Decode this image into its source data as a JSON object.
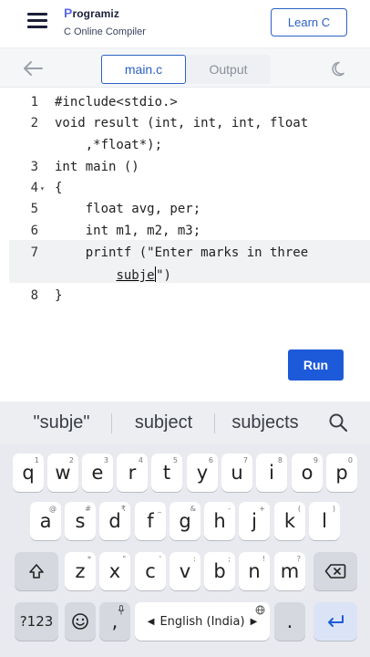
{
  "header": {
    "brand_initial": "P",
    "brand_rest": "rogramiz",
    "subtitle": "C Online Compiler",
    "learn_button": "Learn C"
  },
  "toolbar": {
    "tab_main": "main.c",
    "tab_output": "Output",
    "back_icon": "arrow-left-icon",
    "theme_icon": "moon-icon"
  },
  "editor": {
    "lines": [
      {
        "num": "1",
        "code": "#include<stdio.>"
      },
      {
        "num": "2",
        "code": "void result (int, int, int, float"
      },
      {
        "num": "",
        "code": "    ,*float*);"
      },
      {
        "num": "3",
        "code": "int main ()"
      },
      {
        "num": "4",
        "code": "{"
      },
      {
        "num": "5",
        "code": "    float avg, per;"
      },
      {
        "num": "6",
        "code": "    int m1, m2, m3;"
      },
      {
        "num": "7",
        "code": "    printf (\"Enter marks in three"
      },
      {
        "num": "",
        "code_prefix": "        ",
        "code_word": "subje",
        "code_suffix": "\")"
      },
      {
        "num": "8",
        "code": "}"
      }
    ],
    "fold_marker": "▾",
    "run_button": "Run"
  },
  "keyboard": {
    "suggestions": [
      "\"subje\"",
      "subject",
      "subjects"
    ],
    "row1": [
      {
        "k": "q",
        "h": "1"
      },
      {
        "k": "w",
        "h": "2"
      },
      {
        "k": "e",
        "h": "3"
      },
      {
        "k": "r",
        "h": "4"
      },
      {
        "k": "t",
        "h": "5"
      },
      {
        "k": "y",
        "h": "6"
      },
      {
        "k": "u",
        "h": "7"
      },
      {
        "k": "i",
        "h": "8"
      },
      {
        "k": "o",
        "h": "9"
      },
      {
        "k": "p",
        "h": "0"
      }
    ],
    "row2": [
      {
        "k": "a",
        "h": "@"
      },
      {
        "k": "s",
        "h": "#"
      },
      {
        "k": "d",
        "h": "₹"
      },
      {
        "k": "f",
        "h": "_"
      },
      {
        "k": "g",
        "h": "&"
      },
      {
        "k": "h",
        "h": "-"
      },
      {
        "k": "j",
        "h": "+"
      },
      {
        "k": "k",
        "h": "("
      },
      {
        "k": "l",
        "h": ")"
      }
    ],
    "row3": [
      {
        "k": "z",
        "h": "*"
      },
      {
        "k": "x",
        "h": "\""
      },
      {
        "k": "c",
        "h": "'"
      },
      {
        "k": "v",
        "h": ":"
      },
      {
        "k": "b",
        "h": ";"
      },
      {
        "k": "n",
        "h": "!"
      },
      {
        "k": "m",
        "h": "?"
      }
    ],
    "symbols_key": "?123",
    "comma_key": ",",
    "space_label": "English (India)",
    "period_key": "."
  }
}
